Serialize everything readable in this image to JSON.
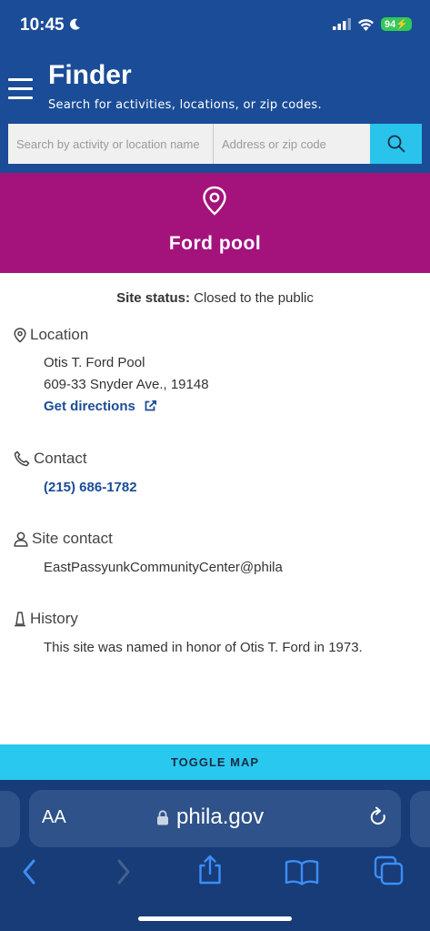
{
  "status_bar": {
    "time": "10:45",
    "battery": "94"
  },
  "header": {
    "title": "Finder",
    "subtitle": "Search for activities, locations, or zip codes.",
    "search_activity_placeholder": "Search by activity or location name",
    "search_address_placeholder": "Address or zip code"
  },
  "hero": {
    "title": "Ford pool"
  },
  "site_status": {
    "label": "Site status:",
    "value": "Closed to the public"
  },
  "location": {
    "heading": "Location",
    "name": "Otis T. Ford Pool",
    "address": "609-33 Snyder Ave., 19148",
    "directions": "Get directions"
  },
  "contact": {
    "heading": "Contact",
    "phone": "(215) 686-1782"
  },
  "site_contact": {
    "heading": "Site contact",
    "email": "EastPassyunkCommunityCenter@phila"
  },
  "history": {
    "heading": "History",
    "text": "This site was named in honor of Otis T. Ford in 1973."
  },
  "toggle_map": "TOGGLE MAP",
  "browser": {
    "text_size": "AA",
    "domain": "phila.gov"
  },
  "colors": {
    "header": "#1b4c97",
    "hero": "#a4127c",
    "accent": "#29c3ec",
    "link": "#1b4c97"
  }
}
